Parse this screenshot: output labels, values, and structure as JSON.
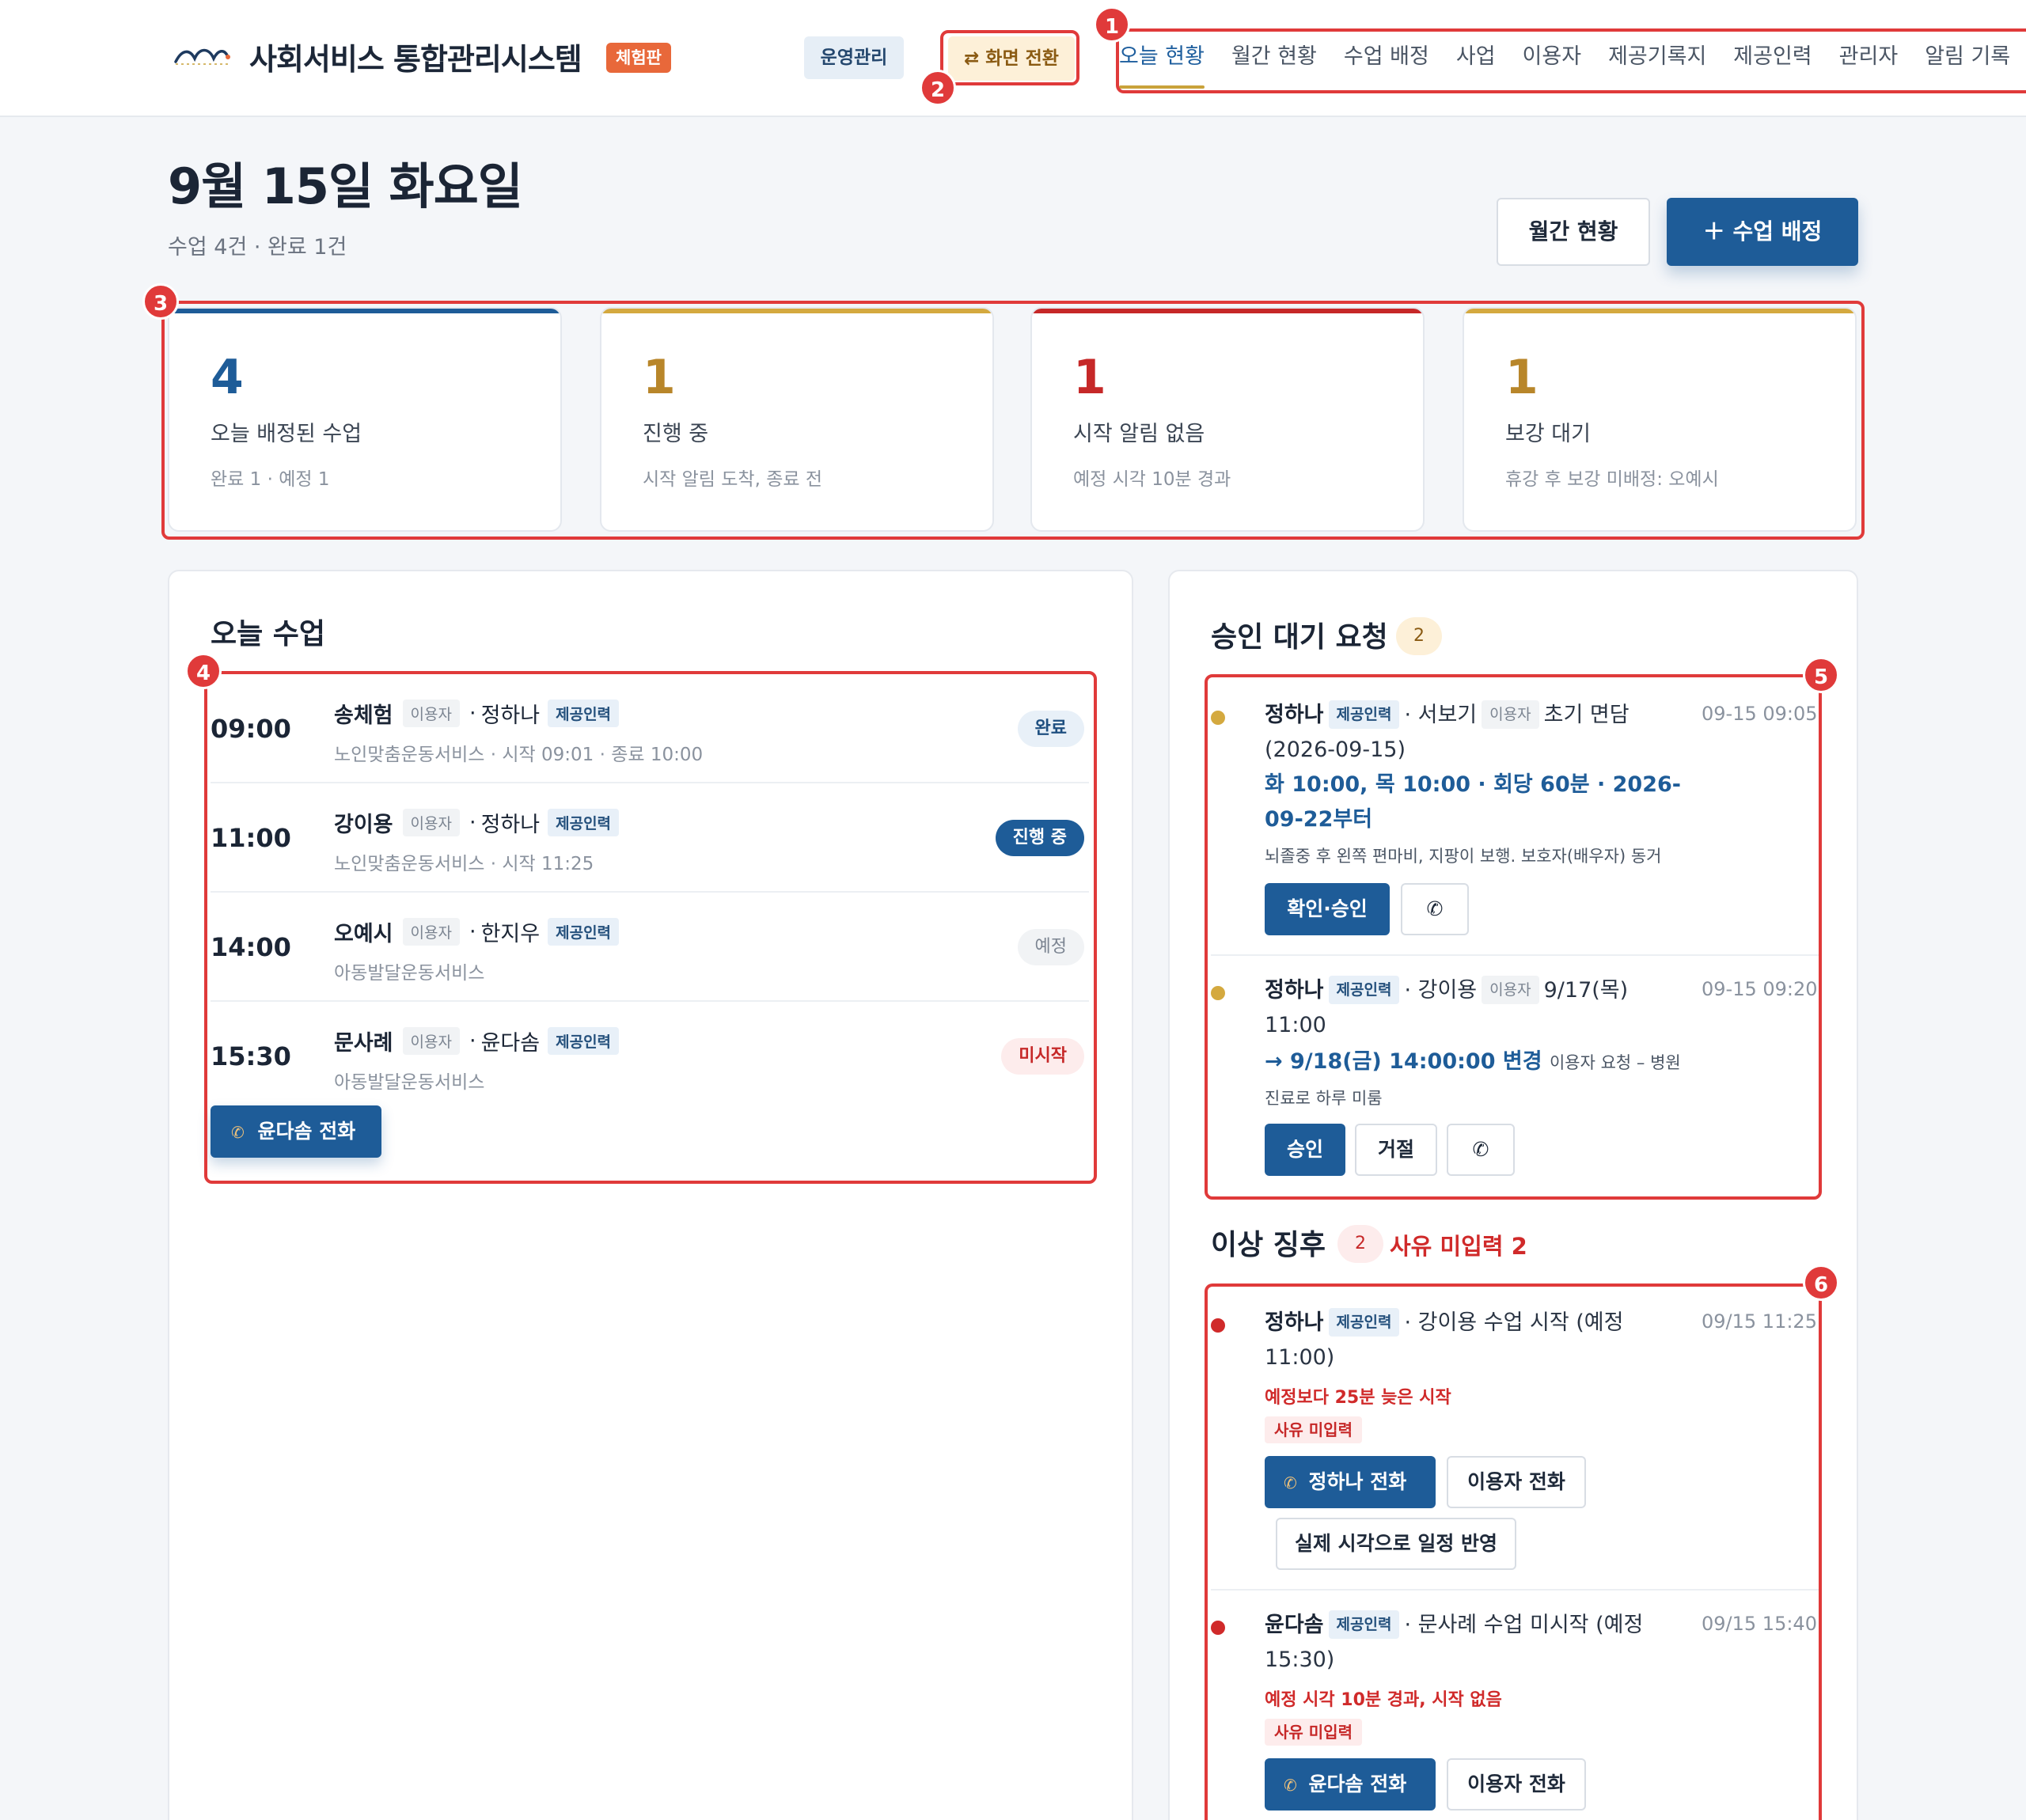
{
  "header": {
    "app_title": "사회서비스 통합관리시스템",
    "edition": "체험판",
    "ops_badge": "운영관리",
    "switch_label": "⇄ 화면 전환",
    "nav": [
      "오늘 현황",
      "월간 현황",
      "수업 배정",
      "사업",
      "이용자",
      "제공기록지",
      "제공인력",
      "관리자",
      "알림 기록"
    ],
    "active_nav": "오늘 현황"
  },
  "page": {
    "date": "9월 15일 화요일",
    "summary": "수업 4건 · 완료 1건",
    "btn_monthly": "월간 현황",
    "btn_assign": "＋ 수업 배정"
  },
  "stats": [
    {
      "value": "4",
      "label": "오늘 배정된 수업",
      "sub": "완료 1 · 예정 1",
      "color": "#1e5c98"
    },
    {
      "value": "1",
      "label": "진행 중",
      "sub": "시작 알림 도착, 종료 전",
      "color": "#b8862a"
    },
    {
      "value": "1",
      "label": "시작 알림 없음",
      "sub": "예정 시각 10분 경과",
      "color": "#c62828"
    },
    {
      "value": "1",
      "label": "보강 대기",
      "sub": "휴강 후 보강 미배정: 오예시",
      "color": "#b8862a"
    }
  ],
  "today": {
    "title": "오늘 수업",
    "user_tag": "이용자",
    "staff_tag": "제공인력",
    "lessons": [
      {
        "time": "09:00",
        "user": "송체험",
        "staff": "정하나",
        "detail": "노인맞춤운동서비스 · 시작 09:01 · 종료 10:00",
        "status": "완료"
      },
      {
        "time": "11:00",
        "user": "강이용",
        "staff": "정하나",
        "detail": "노인맞춤운동서비스 · 시작 11:25",
        "status": "진행 중"
      },
      {
        "time": "14:00",
        "user": "오예시",
        "staff": "한지우",
        "detail": "아동발달운동서비스",
        "status": "예정"
      },
      {
        "time": "15:30",
        "user": "문사례",
        "staff": "윤다솜",
        "detail": "아동발달운동서비스",
        "status": "미시작"
      }
    ],
    "call_button": "윤다솜 전화"
  },
  "approvals": {
    "title": "승인 대기 요청",
    "count": "2",
    "items": [
      {
        "staff": "정하나",
        "user": "서보기",
        "kind": "초기 면담 (2026-09-15)",
        "time": "09-15 09:05",
        "schedule": "화 10:00, 목 10:00 · 회당 60분 · 2026-09-22부터",
        "note": "뇌졸중 후 왼쪽 편마비, 지팡이 보행. 보호자(배우자) 동거",
        "btn_approve": "확인·승인"
      },
      {
        "staff": "정하나",
        "user": "강이용",
        "kind": "9/17(목) 11:00",
        "time": "09-15 09:20",
        "schedule": "→ 9/18(금) 14:00:00 변경",
        "note": "이용자 요청 – 병원 진료로 하루 미룸",
        "btn_approve": "승인",
        "btn_reject": "거절"
      }
    ]
  },
  "anomalies": {
    "title": "이상 징후",
    "count": "2",
    "missing_label": "사유 미입력 2",
    "items": [
      {
        "staff": "정하나",
        "text": "강이용 수업 시작 (예정 11:00)",
        "time": "09/15 11:25",
        "warning": "예정보다 25분 늦은 시작",
        "tag": "사유 미입력",
        "btn_call_staff": "정하나 전화",
        "btn_call_user": "이용자 전화",
        "btn_apply": "실제 시각으로 일정 반영"
      },
      {
        "staff": "윤다솜",
        "text": "문사례 수업 미시작 (예정 15:30)",
        "time": "09/15 15:40",
        "warning": "예정 시각 10분 경과, 시작 없음",
        "tag": "사유 미입력",
        "btn_call_staff": "윤다솜 전화",
        "btn_call_user": "이용자 전화"
      }
    ]
  },
  "annotations": [
    "1",
    "2",
    "3",
    "4",
    "5",
    "6"
  ]
}
